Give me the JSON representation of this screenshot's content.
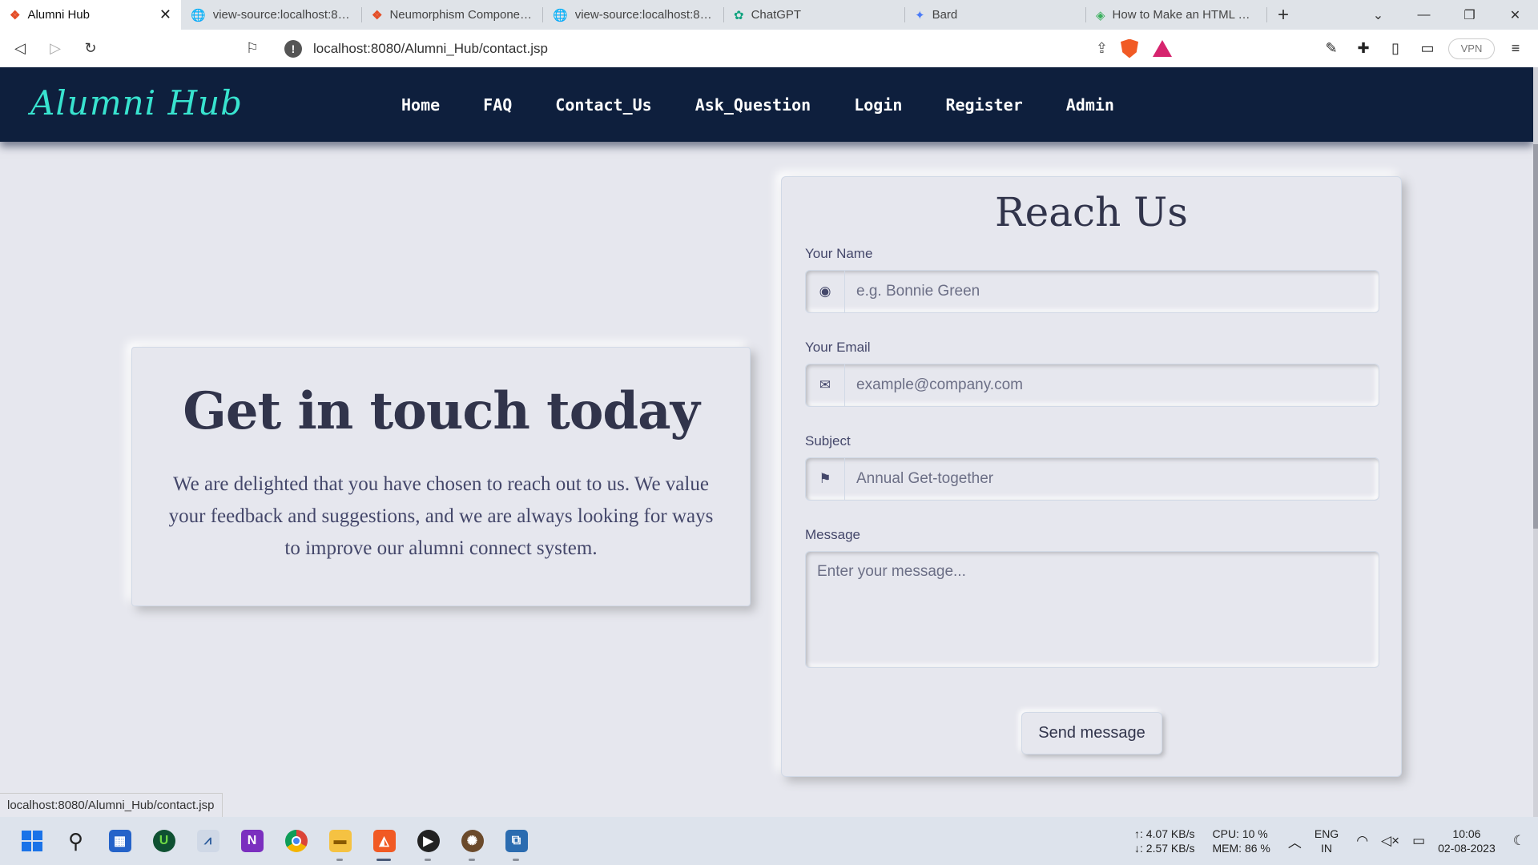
{
  "browser": {
    "tabs": [
      {
        "title": "Alumni Hub",
        "active": true,
        "icon": "html5-icon"
      },
      {
        "title": "view-source:localhost:8080",
        "active": false,
        "icon": "globe-icon"
      },
      {
        "title": "Neumorphism Components",
        "active": false,
        "icon": "html5-icon"
      },
      {
        "title": "view-source:localhost:8080",
        "active": false,
        "icon": "globe-icon"
      },
      {
        "title": "ChatGPT",
        "active": false,
        "icon": "chatgpt-icon"
      },
      {
        "title": "Bard",
        "active": false,
        "icon": "bard-icon"
      },
      {
        "title": "How to Make an HTML Button",
        "active": false,
        "icon": "guide-icon"
      }
    ],
    "url": "localhost:8080/Alumni_Hub/contact.jsp",
    "vpn_label": "VPN",
    "status_url": "localhost:8080/Alumni_Hub/contact.jsp"
  },
  "site": {
    "logo": "Alumni Hub",
    "nav": [
      "Home",
      "FAQ",
      "Contact_Us",
      "Ask_Question",
      "Login",
      "Register",
      "Admin"
    ],
    "intro": {
      "heading": "Get in touch today",
      "body": "We are delighted that you have chosen to reach out to us. We value your feedback and suggestions, and we are always looking for ways to improve our alumni connect system."
    },
    "form": {
      "title": "Reach Us",
      "name_label": "Your Name",
      "name_placeholder": "e.g. Bonnie Green",
      "email_label": "Your Email",
      "email_placeholder": "example@company.com",
      "subject_label": "Subject",
      "subject_placeholder": "Annual Get-together",
      "message_label": "Message",
      "message_placeholder": "Enter your message...",
      "submit_label": "Send message"
    }
  },
  "taskbar": {
    "net_up": "↑: 4.07 KB/s",
    "net_down": "↓: 2.57 KB/s",
    "cpu": "CPU: 10 %",
    "mem": "MEM: 86 %",
    "lang": "ENG",
    "region": "IN",
    "time": "10:06",
    "date": "02-08-2023"
  },
  "colors": {
    "nav_bg": "#0e1f3d",
    "logo": "#38e3cf",
    "page_bg": "#e6e7ee"
  }
}
